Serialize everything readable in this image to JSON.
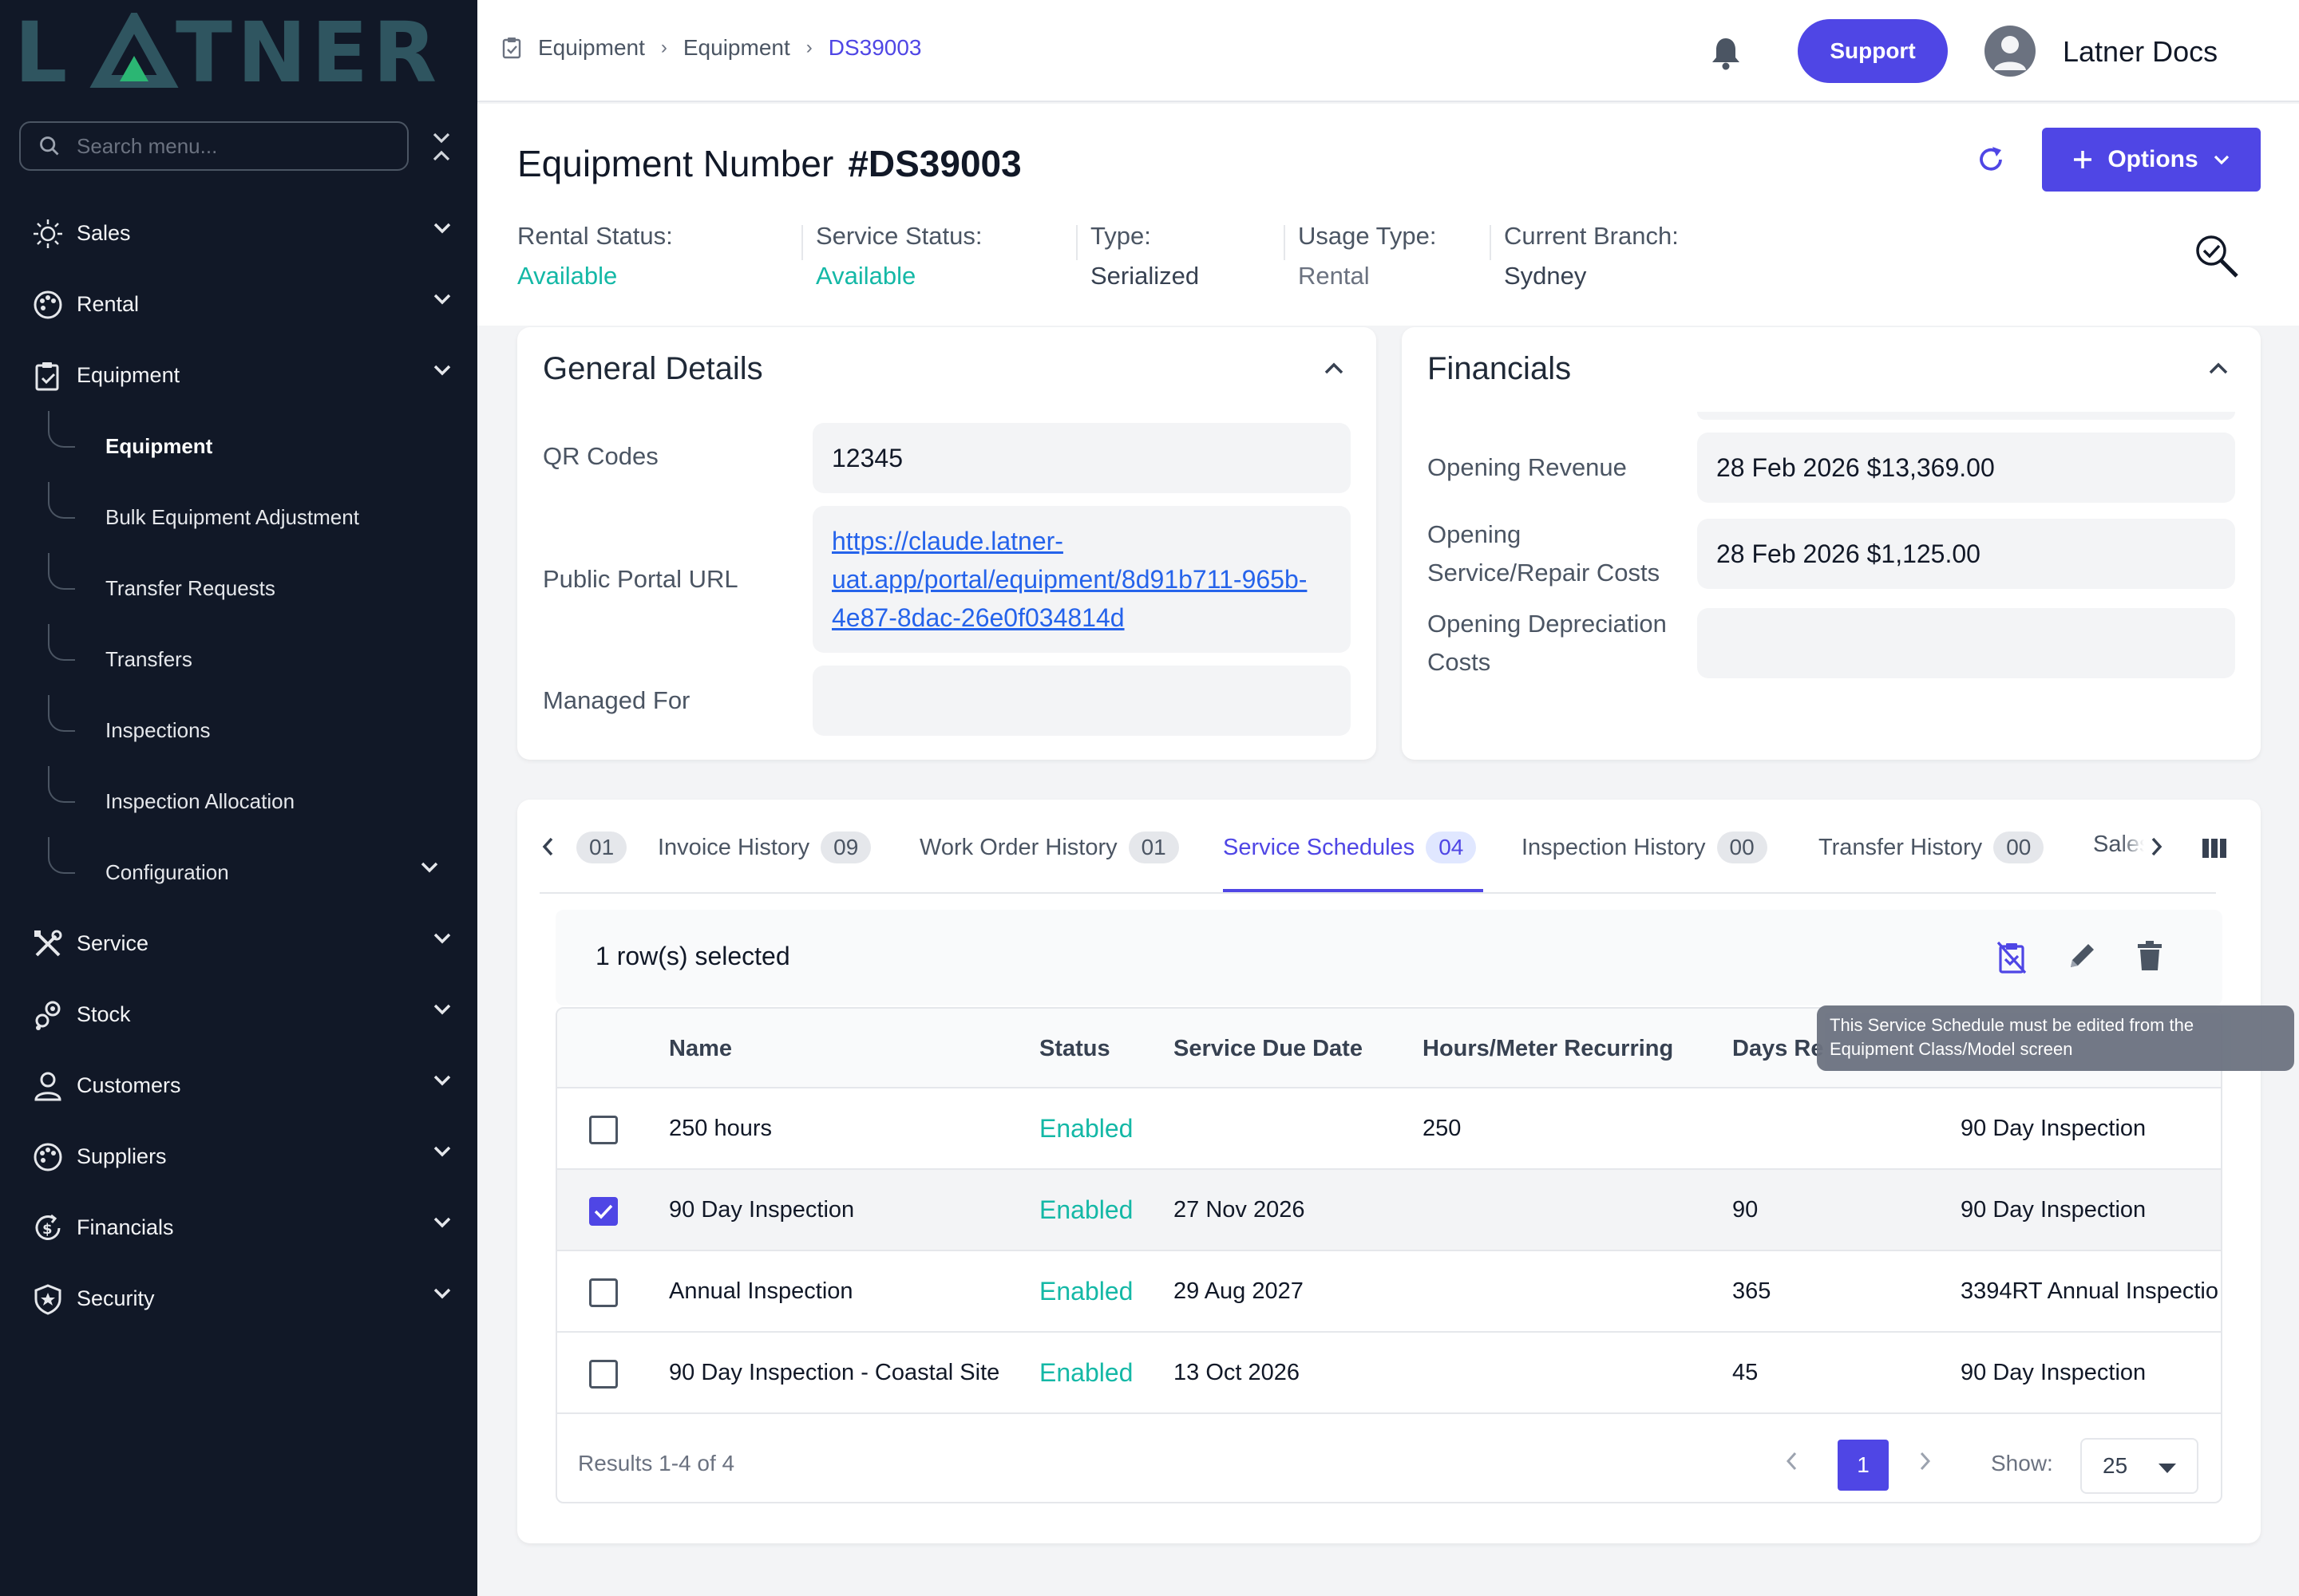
{
  "sidebar": {
    "logo_text": "LATNER",
    "search_placeholder": "Search menu...",
    "items": [
      {
        "label": "Sales",
        "icon": "sun-gear-icon"
      },
      {
        "label": "Rental",
        "icon": "palette-icon"
      },
      {
        "label": "Equipment",
        "icon": "clipboard-icon"
      },
      {
        "label": "Service",
        "icon": "tools-icon"
      },
      {
        "label": "Stock",
        "icon": "bolts-icon"
      },
      {
        "label": "Customers",
        "icon": "user-icon"
      },
      {
        "label": "Suppliers",
        "icon": "palette-icon"
      },
      {
        "label": "Financials",
        "icon": "dollar-cycle-icon"
      },
      {
        "label": "Security",
        "icon": "shield-icon"
      }
    ],
    "equipment_sub": [
      {
        "label": "Equipment"
      },
      {
        "label": "Bulk Equipment Adjustment"
      },
      {
        "label": "Transfer Requests"
      },
      {
        "label": "Transfers"
      },
      {
        "label": "Inspections"
      },
      {
        "label": "Inspection Allocation"
      },
      {
        "label": "Configuration"
      }
    ]
  },
  "topbar": {
    "breadcrumb": [
      "Equipment",
      "Equipment",
      "DS39003"
    ],
    "support_label": "Support",
    "user_name": "Latner Docs"
  },
  "header": {
    "title": "Equipment Number",
    "number": "#DS39003",
    "options_label": "Options",
    "statuses": [
      {
        "label": "Rental Status:",
        "value": "Available"
      },
      {
        "label": "Service Status:",
        "value": "Available"
      },
      {
        "label": "Type:",
        "value": "Serialized"
      },
      {
        "label": "Usage Type:",
        "value": "Rental"
      },
      {
        "label": "Current Branch:",
        "value": "Sydney"
      }
    ]
  },
  "general": {
    "title": "General Details",
    "qr_label": "QR Codes",
    "qr_value": "12345",
    "portal_label": "Public Portal URL",
    "portal_url_l1": "https://claude.latner-",
    "portal_url_l2": "uat.app/portal/equipment/8d91b711-965b-",
    "portal_url_l3": "4e87-8dac-26e0f034814d",
    "managed_label": "Managed For",
    "managed_value": ""
  },
  "financials": {
    "title": "Financials",
    "rev_label": "Opening Revenue",
    "rev_value": "28 Feb 2026  $13,369.00",
    "svc_label_l1": "Opening",
    "svc_label_l2": "Service/Repair Costs",
    "svc_value": "28 Feb 2026  $1,125.00",
    "dep_label_l1": "Opening Depreciation",
    "dep_label_l2": "Costs",
    "dep_value": ""
  },
  "tabs": {
    "first_badge": "01",
    "items": [
      {
        "label": "Invoice History",
        "badge": "09"
      },
      {
        "label": "Work Order History",
        "badge": "01"
      },
      {
        "label": "Service Schedules",
        "badge": "04"
      },
      {
        "label": "Inspection History",
        "badge": "00"
      },
      {
        "label": "Transfer History",
        "badge": "00"
      }
    ],
    "overflow_label": "Sales"
  },
  "table": {
    "selection_text": "1 row(s) selected",
    "columns": [
      "Name",
      "Status",
      "Service Due Date",
      "Hours/Meter Recurring",
      "Days Re"
    ],
    "rows": [
      {
        "name": "250 hours",
        "status": "Enabled",
        "due": "",
        "hours": "250",
        "days": "",
        "template": "90 Day Inspection",
        "checked": false
      },
      {
        "name": "90 Day Inspection",
        "status": "Enabled",
        "due": "27 Nov 2026",
        "hours": "",
        "days": "90",
        "template": "90 Day Inspection",
        "checked": true
      },
      {
        "name": "Annual Inspection",
        "status": "Enabled",
        "due": "29 Aug 2027",
        "hours": "",
        "days": "365",
        "template": "3394RT Annual Inspectio",
        "checked": false
      },
      {
        "name": "90 Day Inspection - Coastal Site",
        "status": "Enabled",
        "due": "13 Oct 2026",
        "hours": "",
        "days": "45",
        "template": "90 Day Inspection",
        "checked": false
      }
    ],
    "results": "Results 1-4 of 4",
    "page": "1",
    "show_label": "Show:",
    "show_value": "25"
  },
  "tooltip": {
    "line1": "This Service Schedule must be edited from the",
    "line2": "Equipment Class/Model screen"
  },
  "colors": {
    "accent": "#4f46e5",
    "sidebar_bg": "#111827",
    "status_green": "#14b8a6",
    "logo_teal": "#2f5560",
    "logo_green": "#2bb673"
  }
}
